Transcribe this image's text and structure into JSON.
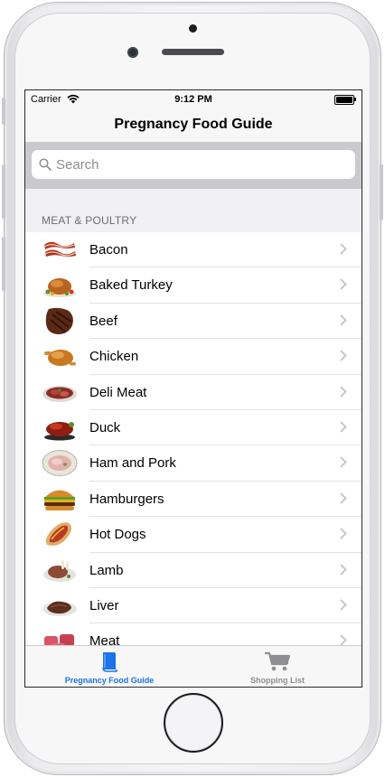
{
  "status_bar": {
    "carrier": "Carrier",
    "time": "9:12 PM"
  },
  "nav": {
    "title": "Pregnancy Food Guide"
  },
  "search": {
    "placeholder": "Search"
  },
  "section": {
    "title": "MEAT & POULTRY"
  },
  "items": [
    {
      "label": "Bacon",
      "icon": "bacon-thumbnail"
    },
    {
      "label": "Baked Turkey",
      "icon": "turkey-thumbnail"
    },
    {
      "label": "Beef",
      "icon": "beef-thumbnail"
    },
    {
      "label": "Chicken",
      "icon": "chicken-thumbnail"
    },
    {
      "label": "Deli Meat",
      "icon": "deli-meat-thumbnail"
    },
    {
      "label": "Duck",
      "icon": "duck-thumbnail"
    },
    {
      "label": "Ham and Pork",
      "icon": "ham-thumbnail"
    },
    {
      "label": "Hamburgers",
      "icon": "hamburger-thumbnail"
    },
    {
      "label": "Hot Dogs",
      "icon": "hot-dog-thumbnail"
    },
    {
      "label": "Lamb",
      "icon": "lamb-thumbnail"
    },
    {
      "label": "Liver",
      "icon": "liver-thumbnail"
    },
    {
      "label": "Meat",
      "icon": "meat-thumbnail"
    }
  ],
  "tabs": [
    {
      "label": "Pregnancy Food Guide",
      "icon": "book-icon",
      "active": true
    },
    {
      "label": "Shopping List",
      "icon": "cart-icon",
      "active": false
    }
  ],
  "colors": {
    "accent": "#1a73e8",
    "inactive": "#8e8e93"
  }
}
